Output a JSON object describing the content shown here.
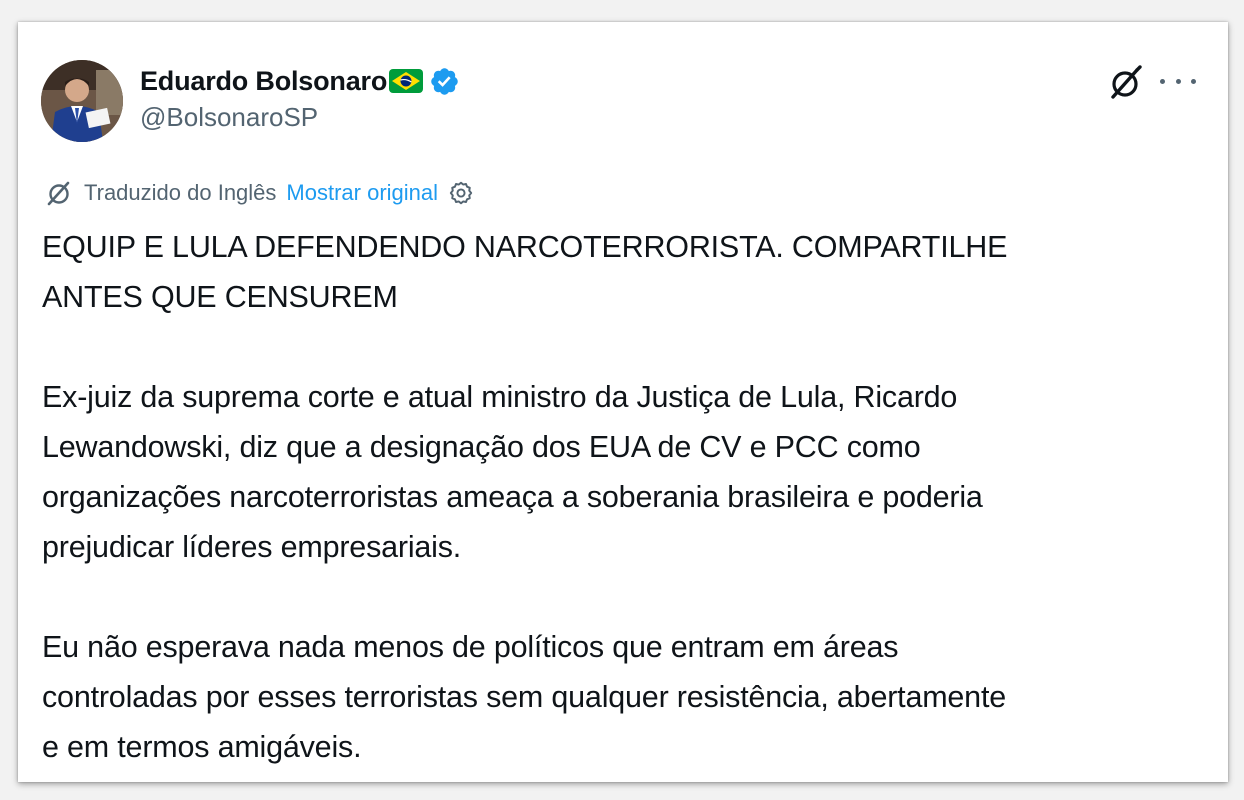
{
  "author": {
    "display_name": "Eduardo Bolsonaro",
    "flag_icon": "brazil-flag-icon",
    "verified_icon": "verified-badge-icon",
    "handle": "@BolsonaroSP"
  },
  "header_actions": {
    "grok_icon": "grok-icon",
    "more_icon": "more-icon"
  },
  "translation": {
    "label": "Traduzido do Inglês",
    "show_original": "Mostrar original"
  },
  "tweet": {
    "line1": "EQUIP E LULA DEFENDENDO NARCOTERRORISTA. COMPARTILHE",
    "line2": "ANTES QUE CENSUREM",
    "line3": "Ex-juiz da suprema corte e atual ministro da Justiça de Lula, Ricardo",
    "line4": "Lewandowski, diz que a designação dos EUA de CV e PCC como",
    "line5": "organizações narcoterroristas ameaça a soberania brasileira e poderia",
    "line6": "prejudicar líderes empresariais.",
    "line7": "Eu não esperava nada menos de políticos que entram em áreas",
    "line8": "controladas por esses terroristas sem qualquer resistência, abertamente",
    "line9": "e em termos amigáveis."
  },
  "colors": {
    "link_blue": "#1d9bf0",
    "text_primary": "#0f1419",
    "text_secondary": "#536471",
    "verified_blue": "#1d9bf0"
  }
}
